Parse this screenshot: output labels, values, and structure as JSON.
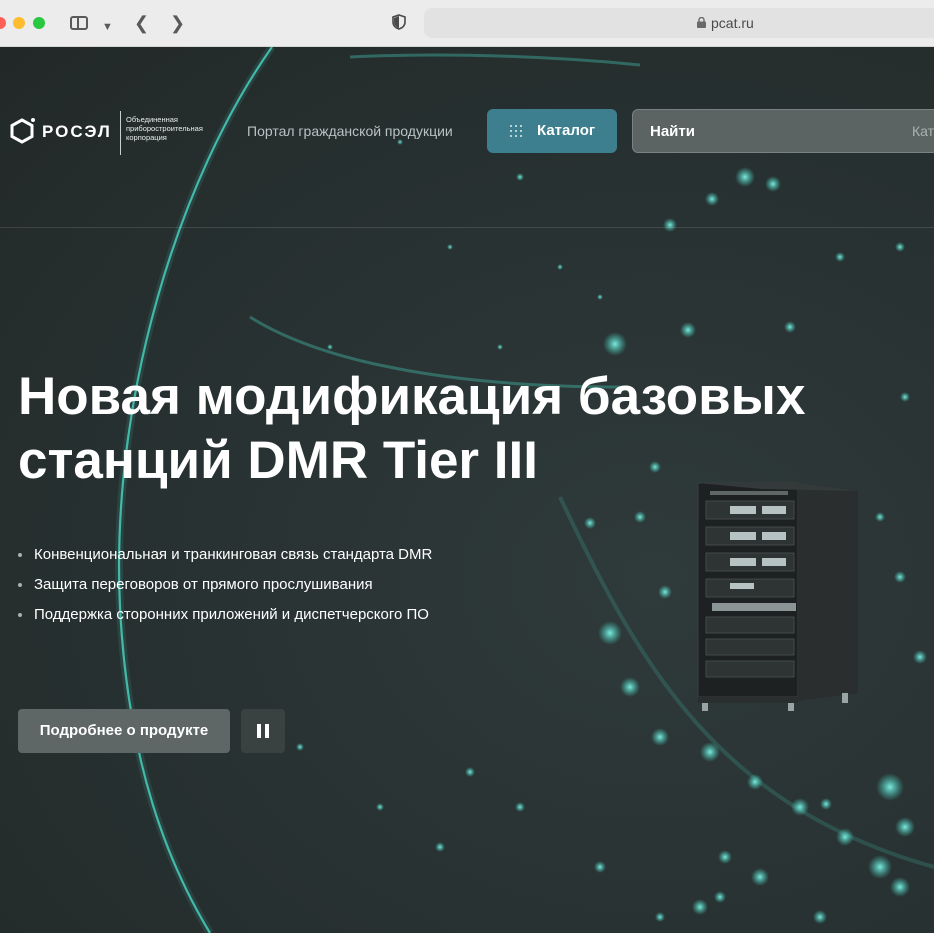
{
  "browser": {
    "url": "pcat.ru"
  },
  "header": {
    "logo_word": "РОСЭЛ",
    "logo_subtitle": "Объединенная приборостроительная корпорация",
    "portal_link": "Портал гражданской продукции",
    "catalog_label": "Каталог",
    "search_label": "Найти",
    "search_cut_text": "Кат"
  },
  "hero": {
    "title": "Новая модификация базовых станций DMR Tier III",
    "bullets": [
      "Конвенциональная и транкинговая связь стандарта DMR",
      "Защита переговоров от прямого прослушивания",
      "Поддержка сторонних приложений и диспетчерского ПО"
    ],
    "more_button": "Подробнее о продукте"
  },
  "colors": {
    "accent": "#3d7f8e",
    "background": "#2b3030",
    "particle": "#3fd0c0"
  },
  "icons": [
    "sidebar-icon",
    "chevron-down-icon",
    "back-icon",
    "forward-icon",
    "shield-icon",
    "lock-icon",
    "grid-icon",
    "pause-icon"
  ]
}
